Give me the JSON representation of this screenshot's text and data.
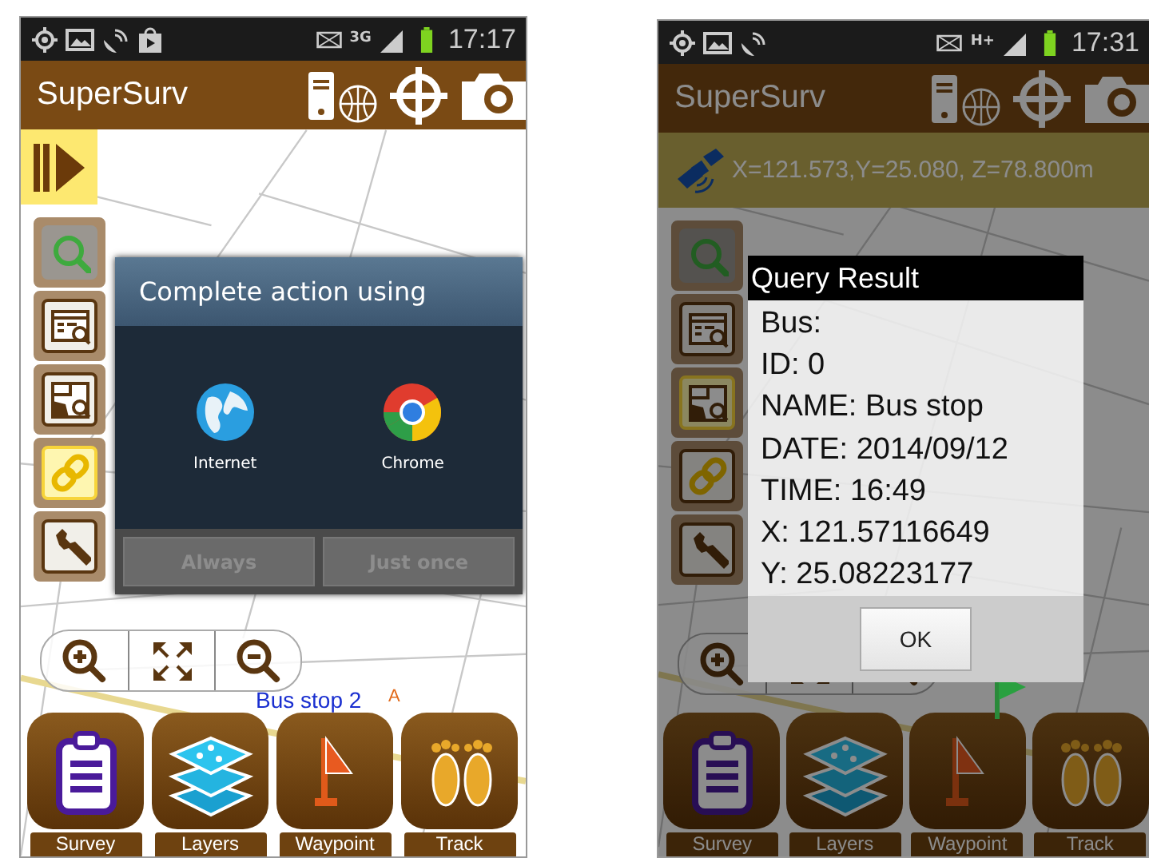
{
  "screens": [
    {
      "status": {
        "notifications": [
          {
            "kind": "gps"
          },
          {
            "kind": "image"
          },
          {
            "kind": "satellite"
          },
          {
            "kind": "store"
          }
        ],
        "network": "3G",
        "time": "17:17"
      },
      "app_title": "SuperSurv",
      "dimmed": false,
      "panel_toggle": {
        "expanded": false
      },
      "tools": [
        {
          "kind": "search",
          "selected": false
        },
        {
          "kind": "table-query",
          "selected": false
        },
        {
          "kind": "map-query",
          "selected": false
        },
        {
          "kind": "link",
          "selected": true
        },
        {
          "kind": "wrench",
          "selected": false
        }
      ],
      "map_labels": [
        {
          "text": "Bus stop 2",
          "kind": "feature"
        },
        {
          "text": "A",
          "kind": "marker"
        }
      ],
      "dialog": {
        "kind": "chooser",
        "title": "Complete action using",
        "apps": [
          {
            "kind": "globe",
            "label": "Internet"
          },
          {
            "kind": "chrome",
            "label": "Chrome"
          }
        ],
        "buttons": [
          {
            "label": "Always",
            "disabled": true
          },
          {
            "label": "Just once",
            "disabled": true
          }
        ]
      },
      "bottom_buttons": [
        {
          "kind": "survey",
          "label": "Survey"
        },
        {
          "kind": "layers",
          "label": "Layers"
        },
        {
          "kind": "waypoint",
          "label": "Waypoint"
        },
        {
          "kind": "track",
          "label": "Track"
        }
      ]
    },
    {
      "status": {
        "notifications": [
          {
            "kind": "gps"
          },
          {
            "kind": "image"
          },
          {
            "kind": "satellite"
          }
        ],
        "network": "H+",
        "time": "17:31"
      },
      "app_title": "SuperSurv",
      "dimmed": true,
      "gps_bar": {
        "text": "X=121.573,Y=25.080, Z=78.800m"
      },
      "map_features": [
        {
          "kind": "flag"
        }
      ],
      "tools": [
        {
          "kind": "search",
          "selected": false
        },
        {
          "kind": "table-query",
          "selected": false
        },
        {
          "kind": "map-query",
          "selected": true
        },
        {
          "kind": "link",
          "selected": false
        },
        {
          "kind": "wrench",
          "selected": false
        }
      ],
      "dialog": {
        "kind": "query",
        "title": "Query Result",
        "lines": [
          "Bus:",
          "ID: 0",
          "NAME: Bus stop",
          "DATE: 2014/09/12",
          "TIME: 16:49",
          "X: 121.57116649",
          "Y: 25.08223177"
        ],
        "buttons": [
          {
            "label": "OK",
            "disabled": false
          }
        ]
      },
      "bottom_buttons": [
        {
          "kind": "survey",
          "label": "Survey"
        },
        {
          "kind": "layers",
          "label": "Layers"
        },
        {
          "kind": "waypoint",
          "label": "Waypoint"
        },
        {
          "kind": "track",
          "label": "Track"
        }
      ]
    }
  ]
}
